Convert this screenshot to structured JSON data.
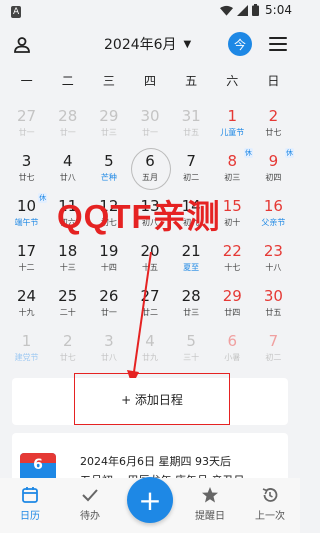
{
  "status_bar": {
    "sim_label": "A",
    "time": "5:04"
  },
  "header": {
    "title": "2024年6月",
    "today_label": "今"
  },
  "weekdays": [
    "一",
    "二",
    "三",
    "四",
    "五",
    "六",
    "日"
  ],
  "days": [
    {
      "n": "27",
      "l": "廿一",
      "other": true
    },
    {
      "n": "28",
      "l": "廿一",
      "other": true
    },
    {
      "n": "29",
      "l": "廿三",
      "other": true
    },
    {
      "n": "30",
      "l": "廿一",
      "other": true
    },
    {
      "n": "31",
      "l": "廿五",
      "other": true
    },
    {
      "n": "1",
      "l": "儿童节",
      "red": true,
      "blue": true
    },
    {
      "n": "2",
      "l": "廿七",
      "red": true
    },
    {
      "n": "3",
      "l": "廿七"
    },
    {
      "n": "4",
      "l": "廿八"
    },
    {
      "n": "5",
      "l": "芒种",
      "blue": true
    },
    {
      "n": "6",
      "l": "五月",
      "today": true
    },
    {
      "n": "7",
      "l": "初二"
    },
    {
      "n": "8",
      "l": "初三",
      "red": true,
      "tag": "休"
    },
    {
      "n": "9",
      "l": "初四",
      "red": true,
      "tag": "休"
    },
    {
      "n": "10",
      "l": "端午节",
      "blue": true,
      "tag": "休"
    },
    {
      "n": "11",
      "l": "初六"
    },
    {
      "n": "12",
      "l": "初七"
    },
    {
      "n": "13",
      "l": "初八"
    },
    {
      "n": "14",
      "l": "初九"
    },
    {
      "n": "15",
      "l": "初十",
      "red": true
    },
    {
      "n": "16",
      "l": "父亲节",
      "red": true,
      "blue": true
    },
    {
      "n": "17",
      "l": "十二"
    },
    {
      "n": "18",
      "l": "十三"
    },
    {
      "n": "19",
      "l": "十四"
    },
    {
      "n": "20",
      "l": "十五"
    },
    {
      "n": "21",
      "l": "夏至",
      "blue": true
    },
    {
      "n": "22",
      "l": "十七",
      "red": true
    },
    {
      "n": "23",
      "l": "十八",
      "red": true
    },
    {
      "n": "24",
      "l": "十九"
    },
    {
      "n": "25",
      "l": "二十"
    },
    {
      "n": "26",
      "l": "廿一"
    },
    {
      "n": "27",
      "l": "廿二"
    },
    {
      "n": "28",
      "l": "廿三"
    },
    {
      "n": "29",
      "l": "廿四",
      "red": true
    },
    {
      "n": "30",
      "l": "廿五",
      "red": true
    },
    {
      "n": "1",
      "l": "建党节",
      "other": true,
      "blue": true
    },
    {
      "n": "2",
      "l": "廿七",
      "other": true
    },
    {
      "n": "3",
      "l": "廿八",
      "other": true
    },
    {
      "n": "4",
      "l": "廿九",
      "other": true
    },
    {
      "n": "5",
      "l": "三十",
      "other": true
    },
    {
      "n": "6",
      "l": "小暑",
      "other": true,
      "red": true
    },
    {
      "n": "7",
      "l": "初二",
      "other": true,
      "red": true
    }
  ],
  "watermark": "QQTF亲测",
  "add_event_label": "+ 添加日程",
  "info": {
    "icon_day": "6",
    "line1": "2024年6月6日 星期四 93天后",
    "line2": "五月初一 甲辰龙年 庚午月 辛丑日"
  },
  "bottom_nav": [
    {
      "label": "日历",
      "active": true
    },
    {
      "label": "待办"
    },
    {
      "label": "提醒日"
    },
    {
      "label": "上一次"
    }
  ],
  "colors": {
    "accent": "#1e88e5",
    "holiday_red": "#e53935",
    "annotation_red": "#e52222"
  }
}
